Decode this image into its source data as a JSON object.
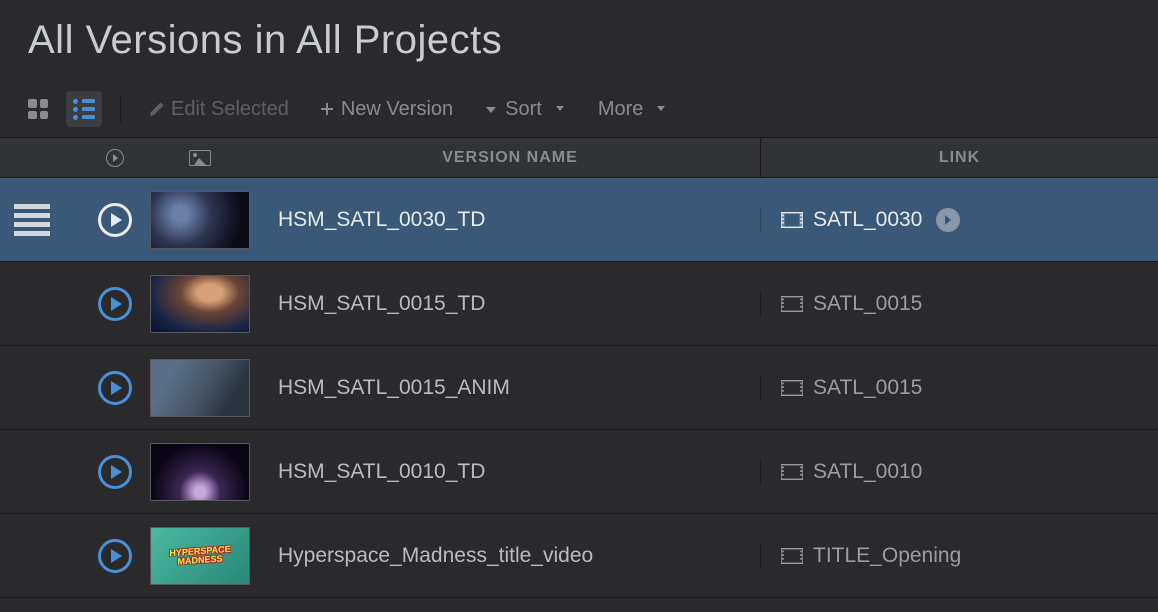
{
  "page": {
    "title": "All Versions in All Projects"
  },
  "toolbar": {
    "edit_label": "Edit Selected",
    "new_label": "New Version",
    "sort_label": "Sort",
    "more_label": "More"
  },
  "columns": {
    "version": "VERSION NAME",
    "link": "LINK"
  },
  "rows": [
    {
      "name": "HSM_SATL_0030_TD",
      "link": "SATL_0030",
      "selected": true
    },
    {
      "name": "HSM_SATL_0015_TD",
      "link": "SATL_0015",
      "selected": false
    },
    {
      "name": "HSM_SATL_0015_ANIM",
      "link": "SATL_0015",
      "selected": false
    },
    {
      "name": "HSM_SATL_0010_TD",
      "link": "SATL_0010",
      "selected": false
    },
    {
      "name": "Hyperspace_Madness_title_video",
      "link": "TITLE_Opening",
      "selected": false
    }
  ],
  "thumb_label": "HYPERSPACE\nMADNESS"
}
